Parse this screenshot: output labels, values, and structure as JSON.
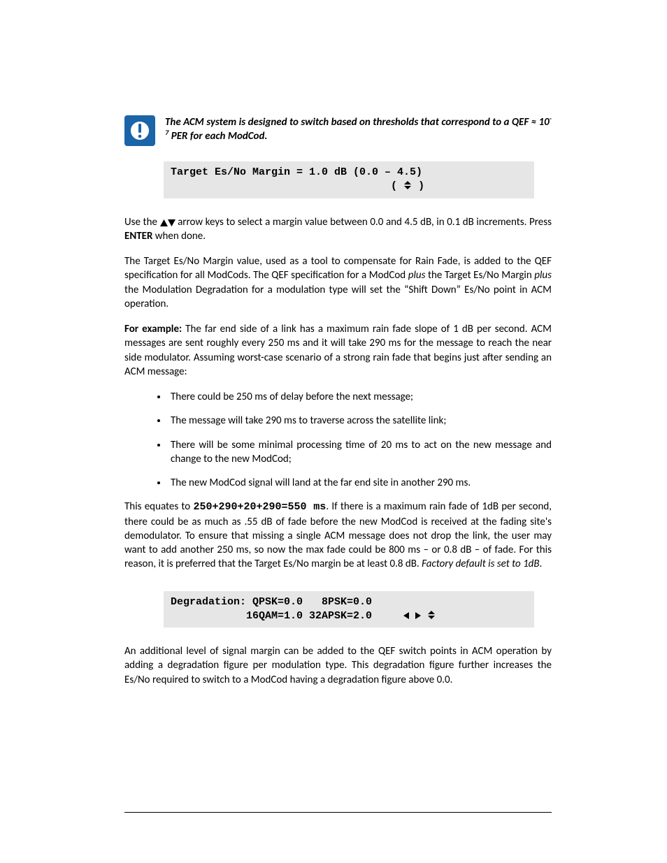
{
  "note": {
    "line1": "The ACM system is designed to switch based on thresholds that correspond to a",
    "line2_prefix": "QEF ≈ 10",
    "line2_sup": "-7",
    "line2_suffix": " PER for each ModCod."
  },
  "lcd1": {
    "line1": "Target Es/No Margin = 1.0 dB (0.0 – 4.5)",
    "line2_pad": "                                   ( ",
    "line2_close": " )"
  },
  "p1": {
    "before": "Use the ",
    "after": " arrow keys to select a margin value between 0.0 and 4.5 dB, in 0.1 dB increments. Press ",
    "bold": "ENTER",
    "tail": " when done."
  },
  "p2": {
    "a": "The Target Es/No Margin value, used as a tool to compensate for Rain Fade, is added to the QEF specification for all ModCods. The QEF specification for a ModCod ",
    "plus1": "plus",
    "b": " the Target Es/No Margin ",
    "plus2": "plus",
    "c": " the Modulation Degradation for a modulation type will set the “Shift Down” Es/No point in ACM operation."
  },
  "p3": {
    "lead": "For example:",
    "body": "  The far end side of a link has a maximum rain fade slope of 1 dB per second. ACM messages are sent roughly every 250 ms and it will take 290 ms for the message to reach the near side modulator. Assuming worst-case scenario of a strong rain fade that begins just after sending an ACM message:"
  },
  "bullets": [
    "There could be 250 ms of delay before the next message;",
    "The message will take 290 ms to traverse across the satellite link;",
    "There will be some minimal processing time of 20 ms to act on the new message and change to the new ModCod;",
    "The new ModCod signal will land at the far end site in another 290 ms."
  ],
  "p4": {
    "a": "This equates to ",
    "calc": "250+290+20+290=550 ms",
    "b": ". If there is a maximum rain fade of 1dB per second, there could be as much as .55 dB of fade before the new ModCod is received at the fading site's demodulator. To ensure that missing a single ACM message does not drop the link, the user may want to add another 250 ms, so now the max fade could be 800 ms – or 0.8 dB – of fade. For this reason, it is preferred that the Target Es/No margin be at least 0.8 dB. ",
    "ital": "Factory default is set to 1dB",
    "c": "."
  },
  "lcd2": {
    "line1": "Degradation: QPSK=0.0   8PSK=0.0",
    "line2": "            16QAM=1.0 32APSK=2.0     "
  },
  "p5": "An additional level of signal margin can be added to the QEF switch points in ACM operation by adding a degradation figure per modulation type. This degradation figure further increases the Es/No required to switch to a ModCod having a degradation figure above 0.0."
}
